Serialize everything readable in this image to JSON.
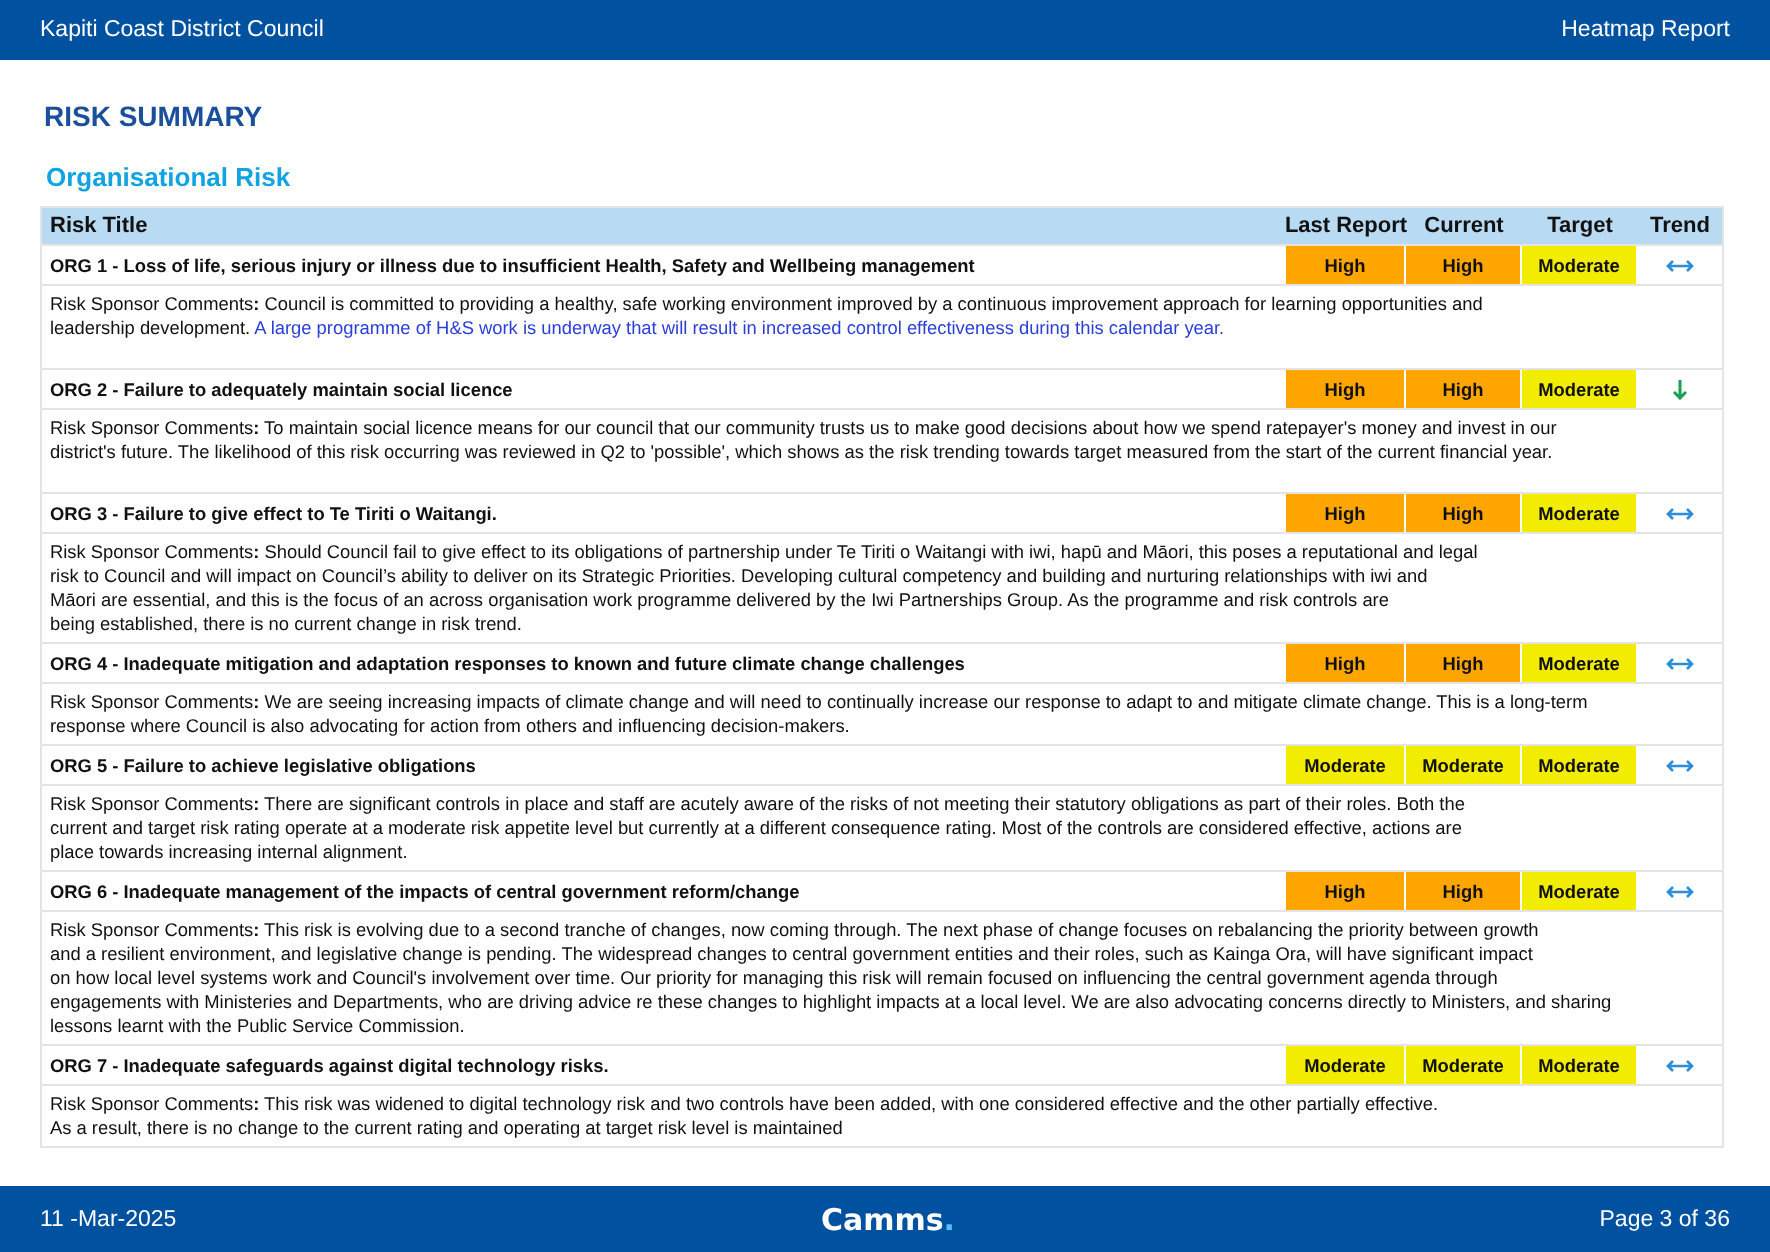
{
  "header": {
    "organisation": "Kapiti Coast District Council",
    "report": "Heatmap Report"
  },
  "title": "RISK SUMMARY",
  "subtitle": "Organisational Risk",
  "columns": [
    "Risk Title",
    "Last Report",
    "Current",
    "Target",
    "Trend"
  ],
  "risks": [
    {
      "title": "ORG 1 - Loss of life, serious injury or illness due to insufficient Health, Safety and Wellbeing management",
      "ratings": [
        {
          "label": "High",
          "color": "#ffa500"
        },
        {
          "label": "High",
          "color": "#ffa500"
        },
        {
          "label": "Moderate",
          "color": "#f2ec00"
        }
      ],
      "trend": {
        "kind": "steady"
      },
      "comment_lines": [
        "Risk Sponsor Comments**:** Council is committed to providing a healthy, safe working environment improved by a continuous improvement approach for learning opportunities and",
        "leadership development."
      ],
      "note": "A large programme of H&S work is underway that will result in increased control effectiveness during this calendar year."
    },
    {
      "title": "ORG 2 - Failure to adequately maintain social licence",
      "ratings": [
        {
          "label": "High",
          "color": "#ffa500"
        },
        {
          "label": "High",
          "color": "#ffa500"
        },
        {
          "label": "Moderate",
          "color": "#f2ec00"
        }
      ],
      "trend": {
        "kind": "down"
      },
      "comment_lines": [
        "Risk Sponsor Comments**:** To maintain social licence means for our council that our community trusts us to make good decisions about how we spend ratepayer's money and invest in our",
        "district's future. The likelihood of this risk occurring was reviewed in Q2 to 'possible', which shows as the risk trending towards target measured from the start of the current financial year."
      ]
    },
    {
      "title": "ORG 3 - Failure to give effect to Te Tiriti o Waitangi.",
      "ratings": [
        {
          "label": "High",
          "color": "#ffa500"
        },
        {
          "label": "High",
          "color": "#ffa500"
        },
        {
          "label": "Moderate",
          "color": "#f2ec00"
        }
      ],
      "trend": {
        "kind": "steady"
      },
      "comment_lines": [
        "Risk Sponsor Comments**:** Should Council fail to give effect to its obligations of partnership under Te Tiriti o Waitangi with iwi, hapū and Māori, this poses a reputational and legal",
        "risk to Council and will impact on Council’s ability to deliver on its Strategic Priorities. Developing cultural competency and building and nurturing relationships with iwi and",
        "Māori are essential, and this is the focus of an across organisation work programme delivered by the Iwi Partnerships Group. As the programme and risk controls are",
        "being established, there is no current change in risk trend."
      ]
    },
    {
      "title": "ORG 4 - Inadequate mitigation and adaptation responses to known and future climate change challenges",
      "ratings": [
        {
          "label": "High",
          "color": "#ffa500"
        },
        {
          "label": "High",
          "color": "#ffa500"
        },
        {
          "label": "Moderate",
          "color": "#f2ec00"
        }
      ],
      "trend": {
        "kind": "steady"
      },
      "comment_lines": [
        "Risk Sponsor Comments**:** We are seeing increasing impacts of climate change and will need to continually increase our response to adapt to and mitigate climate change. This is a long-term",
        "response where Council is also advocating for action from others and influencing decision-makers."
      ]
    },
    {
      "title": "ORG 5 - Failure to achieve legislative obligations",
      "ratings": [
        {
          "label": "Moderate",
          "color": "#f2ec00"
        },
        {
          "label": "Moderate",
          "color": "#f2ec00"
        },
        {
          "label": "Moderate",
          "color": "#f2ec00"
        }
      ],
      "trend": {
        "kind": "steady"
      },
      "comment_lines": [
        "Risk Sponsor Comments**:** There are significant controls in place and staff are acutely aware of the risks of not meeting their statutory obligations as part of their roles. Both the",
        "current and target risk rating operate at a moderate risk appetite level but currently at a different consequence rating. Most of the controls are considered effective, actions are",
        "place towards increasing internal alignment."
      ]
    },
    {
      "title": "ORG 6 - Inadequate management of the impacts of central government reform/change",
      "ratings": [
        {
          "label": "High",
          "color": "#ffa500"
        },
        {
          "label": "High",
          "color": "#ffa500"
        },
        {
          "label": "Moderate",
          "color": "#f2ec00"
        }
      ],
      "trend": {
        "kind": "steady"
      },
      "comment_lines": [
        "Risk Sponsor Comments**:** This risk is evolving due to a second tranche of changes, now coming through. The next phase of change focuses on rebalancing the priority between growth",
        "and a resilient environment, and legislative change is pending. The widespread changes to central government entities and their roles, such as Kainga Ora, will have significant impact",
        "on how local level systems work and Council's involvement over time. Our priority for managing this risk will remain focused on influencing the central government agenda through",
        "engagements with Ministeries and Departments, who are driving advice re these changes to highlight impacts at a local level. We are also advocating concerns directly to Ministers, and sharing",
        "lessons learnt with the Public Service Commission."
      ]
    },
    {
      "title": "ORG 7 - Inadequate safeguards against digital technology risks.",
      "ratings": [
        {
          "label": "Moderate",
          "color": "#f2ec00"
        },
        {
          "label": "Moderate",
          "color": "#f2ec00"
        },
        {
          "label": "Moderate",
          "color": "#f2ec00"
        }
      ],
      "trend": {
        "kind": "steady"
      },
      "comment_lines": [
        "Risk Sponsor Comments**:** This risk was widened to digital technology risk and two controls have been added, with one considered effective and the other partially effective.",
        "As a result, there is no change to the current rating and operating at target risk level is maintained"
      ]
    }
  ],
  "footer": {
    "date": "11 -Mar-2025",
    "logo": "Camms.",
    "page": "Page 3 of 36"
  }
}
